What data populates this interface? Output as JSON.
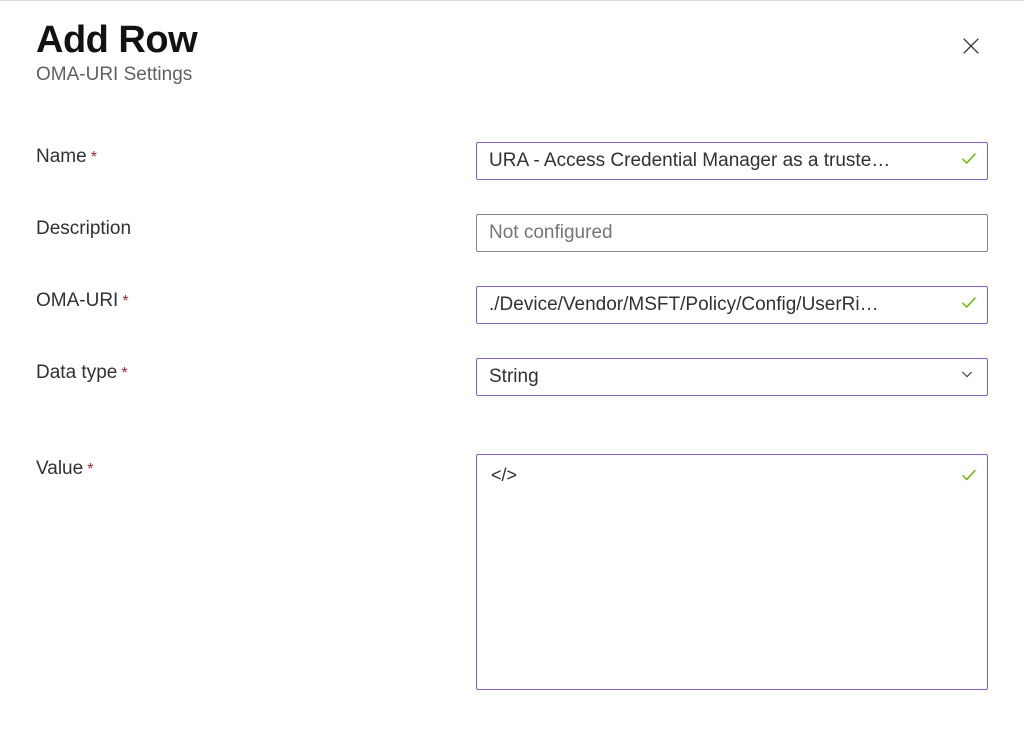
{
  "header": {
    "title": "Add Row",
    "subtitle": "OMA-URI Settings"
  },
  "fields": {
    "name": {
      "label": "Name",
      "required": true,
      "value": "URA - Access Credential Manager as a truste…",
      "validated": true
    },
    "description": {
      "label": "Description",
      "required": false,
      "placeholder": "Not configured",
      "value": ""
    },
    "omauri": {
      "label": "OMA-URI",
      "required": true,
      "value": "./Device/Vendor/MSFT/Policy/Config/UserRi…",
      "validated": true
    },
    "datatype": {
      "label": "Data type",
      "required": true,
      "selected": "String",
      "validated": true
    },
    "value": {
      "label": "Value",
      "required": true,
      "value": "</>",
      "validated": true
    }
  }
}
